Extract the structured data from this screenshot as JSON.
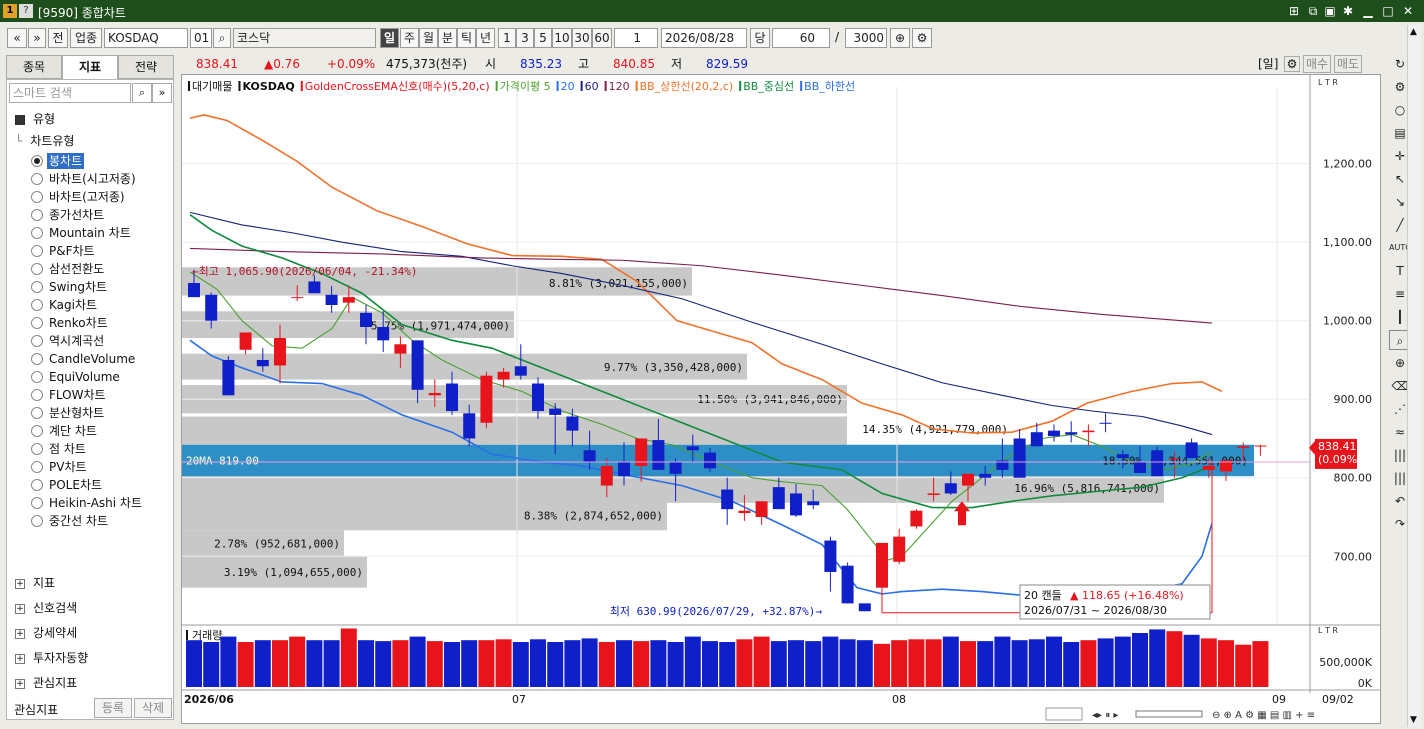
{
  "window": {
    "num": "1",
    "help": "?",
    "title": "[9590] 종합차트"
  },
  "toolbar": {
    "prev": "«",
    "down": "»",
    "jeon": "전",
    "upjong": "업종",
    "market": "KOSDAQ",
    "code": "01",
    "search": "⌕",
    "name": "코스닥",
    "periods": [
      "일",
      "주",
      "월",
      "분",
      "틱",
      "년"
    ],
    "nums": [
      "1",
      "3",
      "5",
      "10",
      "30",
      "60"
    ],
    "count": "1",
    "date": "2026/08/28",
    "dang": "당",
    "n1": "60",
    "slash": "/",
    "n2": "3000"
  },
  "price": {
    "current": "838.41",
    "change": "▲0.76",
    "pct": "+0.09%",
    "volume": "475,373(천주)",
    "open_label": "시",
    "open": "835.23",
    "high_label": "고",
    "high": "840.85",
    "low_label": "저",
    "low": "829.59",
    "period": "[일]",
    "buy": "매수",
    "sell": "매도"
  },
  "left": {
    "tabs": [
      "종목",
      "지표",
      "전략"
    ],
    "search_placeholder": "스마트 검색",
    "type_header": "유형",
    "subheader": "차트유형",
    "items": [
      "봉차트",
      "바차트(시고저종)",
      "바차트(고저종)",
      "종가선차트",
      "Mountain 차트",
      "P&F차트",
      "삼선전환도",
      "Swing차트",
      "Kagi차트",
      "Renko차트",
      "역시계곡선",
      "CandleVolume",
      "EquiVolume",
      "FLOW차트",
      "분산형차트",
      "계단 차트",
      "점 차트",
      "PV차트",
      "POLE차트",
      "Heikin-Ashi 차트",
      "중간선 차트"
    ],
    "groups": [
      "지표",
      "신호검색",
      "강세약세",
      "투자자동향",
      "관심지표"
    ],
    "fav_label": "관심지표",
    "reg": "등록",
    "del": "삭제"
  },
  "legend": [
    "대기매물",
    "KOSDAQ",
    "GoldenCrossEMA신호(매수)(5,20,c)",
    "가격이평 5",
    "20",
    "60",
    "120",
    "BB_상한선(20,2,c)",
    "BB_중심선",
    "BB_하한선"
  ],
  "ltr": "L T R",
  "ma_label": "20MA 819.00",
  "overlay": {
    "high": "최고 1,065.90(2026/06/04, -21.34%)",
    "low": "최저 630.99(2026/07/29, +32.87%)",
    "box1": "20 캔들",
    "box2": "▲ 118.65 (+16.48%)",
    "box3": "2026/07/31 ~ 2026/08/30"
  },
  "price_tag": {
    "v": "838.41",
    "p": "(0.09%)"
  },
  "volume_title": "거래량",
  "vol_ticks": [
    "500,000K",
    "0K"
  ],
  "x_labels": [
    "2026/06",
    "07",
    "08",
    "09",
    "09/02"
  ],
  "colors": {
    "up": "#e8141c",
    "down": "#1020c8",
    "ma5": "#4aa12f",
    "ma20": "#108a3e",
    "ma60": "#17207a",
    "ma120": "#7a1f4e",
    "bbu": "#f0722a",
    "bbl": "#2a6fe8",
    "bar": "#c8c8c8",
    "band": "#2e8fc7"
  },
  "chart_data": {
    "type": "candlestick",
    "title": "",
    "ylim": [
      615,
      1290
    ],
    "yticks": [
      700,
      800,
      900,
      1000,
      1100,
      1200
    ],
    "ytick_labels": [
      "700.00",
      "800.00",
      "900.00",
      "1,000.00",
      "1,100.00",
      "1,200.00"
    ],
    "candles": [
      [
        1048,
        1065,
        1032,
        1030
      ],
      [
        1033,
        1036,
        990,
        1000
      ],
      [
        950,
        955,
        905,
        905
      ],
      [
        963,
        985,
        957,
        985
      ],
      [
        950,
        965,
        935,
        942
      ],
      [
        943,
        995,
        920,
        978
      ],
      [
        1030,
        1045,
        1025,
        1030
      ],
      [
        1050,
        1058,
        1038,
        1035
      ],
      [
        1033,
        1044,
        1010,
        1020
      ],
      [
        1023,
        1045,
        1010,
        1030
      ],
      [
        1010,
        1020,
        970,
        992
      ],
      [
        992,
        1012,
        960,
        975
      ],
      [
        958,
        980,
        940,
        970
      ],
      [
        975,
        975,
        895,
        912
      ],
      [
        905,
        925,
        890,
        908
      ],
      [
        920,
        935,
        880,
        885
      ],
      [
        882,
        893,
        840,
        850
      ],
      [
        870,
        935,
        863,
        930
      ],
      [
        925,
        940,
        915,
        935
      ],
      [
        942,
        970,
        925,
        930
      ],
      [
        920,
        928,
        875,
        885
      ],
      [
        888,
        895,
        830,
        880
      ],
      [
        878,
        888,
        840,
        860
      ],
      [
        835,
        860,
        810,
        820
      ],
      [
        790,
        825,
        775,
        815
      ],
      [
        820,
        845,
        790,
        802
      ],
      [
        815,
        850,
        795,
        850
      ],
      [
        848,
        875,
        815,
        810
      ],
      [
        820,
        825,
        770,
        805
      ],
      [
        840,
        855,
        820,
        835
      ],
      [
        832,
        838,
        807,
        812
      ],
      [
        785,
        800,
        740,
        760
      ],
      [
        755,
        778,
        745,
        758
      ],
      [
        750,
        760,
        740,
        770
      ],
      [
        788,
        800,
        760,
        760
      ],
      [
        780,
        792,
        750,
        752
      ],
      [
        770,
        785,
        760,
        765
      ],
      [
        720,
        725,
        655,
        680
      ],
      [
        688,
        692,
        655,
        640
      ],
      [
        640,
        630,
        675,
        630
      ],
      [
        660,
        708,
        656,
        717
      ],
      [
        693,
        735,
        690,
        725
      ],
      [
        738,
        760,
        735,
        758
      ],
      [
        778,
        800,
        770,
        780
      ],
      [
        793,
        808,
        778,
        780
      ],
      [
        790,
        800,
        770,
        805
      ],
      [
        805,
        815,
        790,
        800
      ],
      [
        822,
        850,
        800,
        810
      ],
      [
        850,
        862,
        800,
        800
      ],
      [
        858,
        870,
        848,
        840
      ],
      [
        860,
        868,
        846,
        853
      ],
      [
        858,
        872,
        845,
        855
      ],
      [
        858,
        868,
        840,
        860
      ],
      [
        870,
        882,
        858,
        869
      ],
      [
        830,
        835,
        812,
        825
      ],
      [
        820,
        840,
        810,
        806
      ],
      [
        835,
        840,
        823,
        802
      ],
      [
        825,
        833,
        800,
        825
      ],
      [
        845,
        850,
        830,
        825
      ],
      [
        810,
        825,
        800,
        815
      ],
      [
        808,
        823,
        796,
        822
      ],
      [
        838,
        845,
        820,
        840
      ],
      [
        840,
        842,
        828,
        841
      ]
    ],
    "volume": [
      520,
      500,
      560,
      500,
      520,
      520,
      560,
      520,
      520,
      650,
      520,
      510,
      520,
      560,
      510,
      500,
      520,
      520,
      530,
      500,
      530,
      500,
      520,
      540,
      500,
      520,
      510,
      520,
      500,
      560,
      510,
      500,
      530,
      560,
      510,
      520,
      510,
      560,
      530,
      520,
      480,
      520,
      530,
      530,
      560,
      510,
      510,
      560,
      520,
      530,
      560,
      500,
      520,
      540,
      560,
      600,
      640,
      620,
      580,
      540,
      520,
      470,
      510
    ]
  }
}
